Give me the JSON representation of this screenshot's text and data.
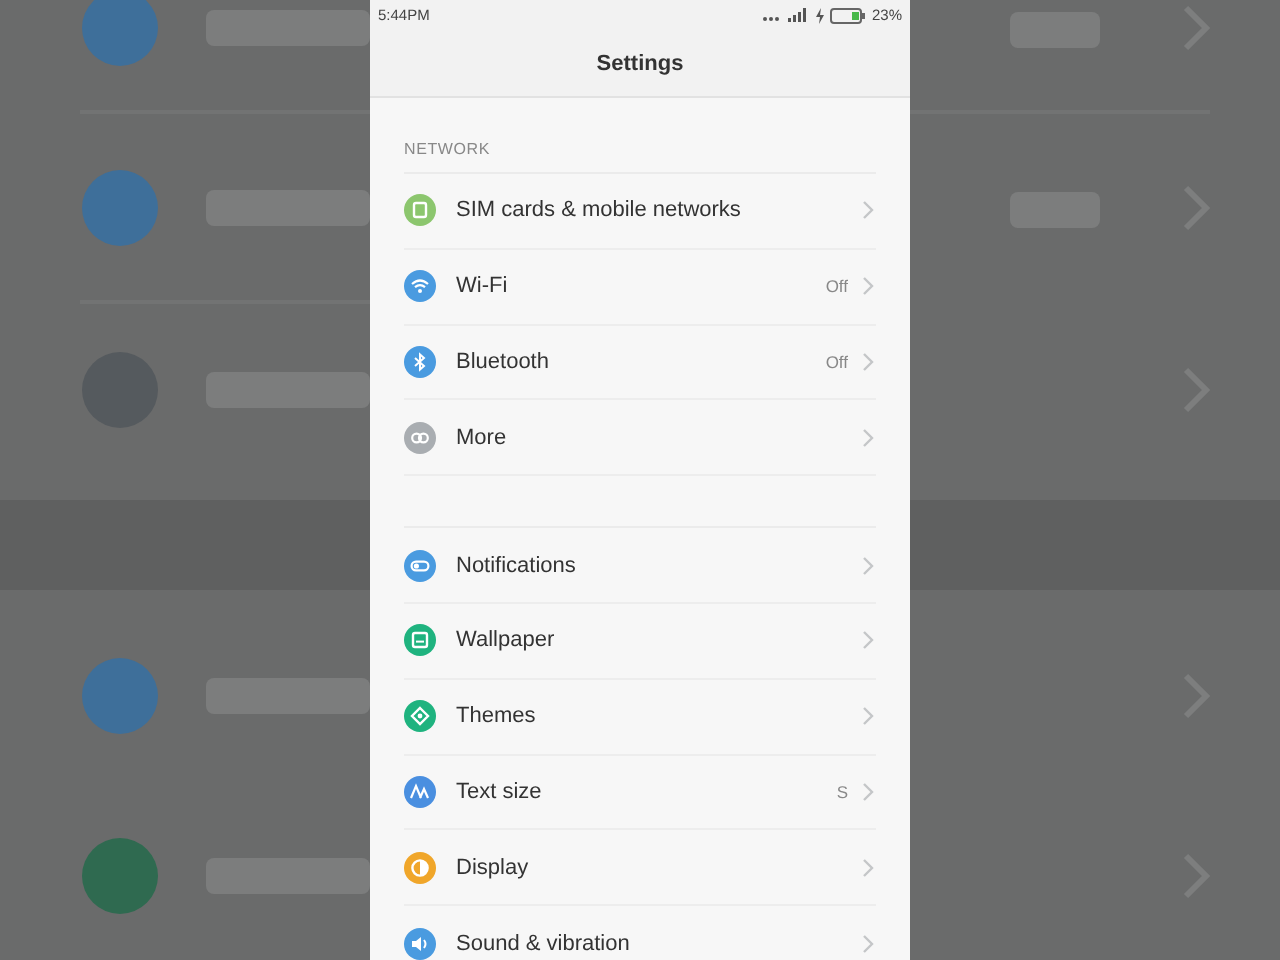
{
  "status_bar": {
    "time": "5:44PM",
    "battery": "23%"
  },
  "header": {
    "title": "Settings"
  },
  "sections": [
    {
      "label": "NETWORK",
      "items": [
        {
          "kind": "sim",
          "label": "SIM cards & mobile networks",
          "color": "#8cc66e"
        },
        {
          "kind": "wifi",
          "label": "Wi-Fi",
          "value": "Off",
          "color": "#4a9be0"
        },
        {
          "kind": "bluetooth",
          "label": "Bluetooth",
          "value": "Off",
          "color": "#4a9be0"
        },
        {
          "kind": "more",
          "label": "More",
          "color": "#a9adb1"
        }
      ]
    },
    {
      "items": [
        {
          "kind": "notifications",
          "label": "Notifications",
          "color": "#4a9be0"
        },
        {
          "kind": "wallpaper",
          "label": "Wallpaper",
          "color": "#1fb37f"
        },
        {
          "kind": "themes",
          "label": "Themes",
          "color": "#1fb37f"
        },
        {
          "kind": "textsize",
          "label": "Text size",
          "value": "S",
          "color": "#4a8fe0"
        },
        {
          "kind": "display",
          "label": "Display",
          "color": "#f0a62a"
        },
        {
          "kind": "sound",
          "label": "Sound & vibration",
          "color": "#4a9be0"
        }
      ]
    }
  ]
}
